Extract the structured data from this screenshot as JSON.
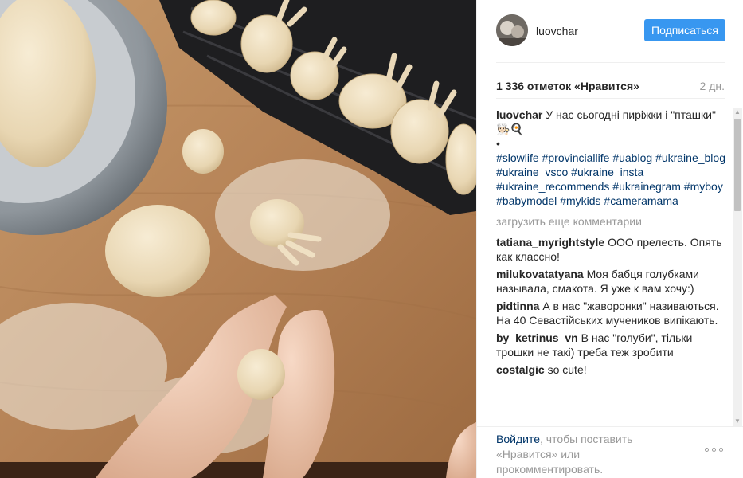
{
  "post": {
    "photo_alt": "",
    "header": {
      "username": "luovchar",
      "follow_label": "Подписаться"
    },
    "likes_text": "1 336 отметок «Нравится»",
    "time_ago": "2 дн.",
    "caption": {
      "username": "luovchar",
      "text": "У нас сьогодні пиріжки і \"пташки\" 🧑🏻‍🍳🍳",
      "bullet": "•",
      "hashtags": [
        "#slowlife",
        "#provinciallife",
        "#uablog",
        "#ukraine_blog",
        "#ukraine_vsco",
        "#ukraine_insta",
        "#ukraine_recommends",
        "#ukrainegram",
        "#myboy",
        "#babymodel",
        "#mykids",
        "#cameramama"
      ]
    },
    "load_more_label": "загрузить еще комментарии",
    "comments": [
      {
        "username": "tatiana_myrightstyle",
        "text": "ООО прелесть. Опять как классно!"
      },
      {
        "username": "milukovatatyana",
        "text": "Моя бабця голубками называла, смакота. Я уже к вам хочу:)"
      },
      {
        "username": "pidtinna",
        "text": "А в нас \"жаворонки\" називаються. На 40 Севастійських мучеников випікають."
      },
      {
        "username": "by_ketrinus_vn",
        "text": "В нас \"голуби\", тільки трошки не такі) треба теж зробити"
      },
      {
        "username": "costalgic",
        "text": "so cute!"
      }
    ],
    "footer": {
      "login_link": "Войдите",
      "rest_text": ", чтобы поставить «Нравится» или прокомментировать."
    },
    "more_icon": "ellipsis-icon"
  },
  "colors": {
    "accent": "#3897f0",
    "link": "#003569",
    "muted": "#999999",
    "text": "#262626"
  }
}
